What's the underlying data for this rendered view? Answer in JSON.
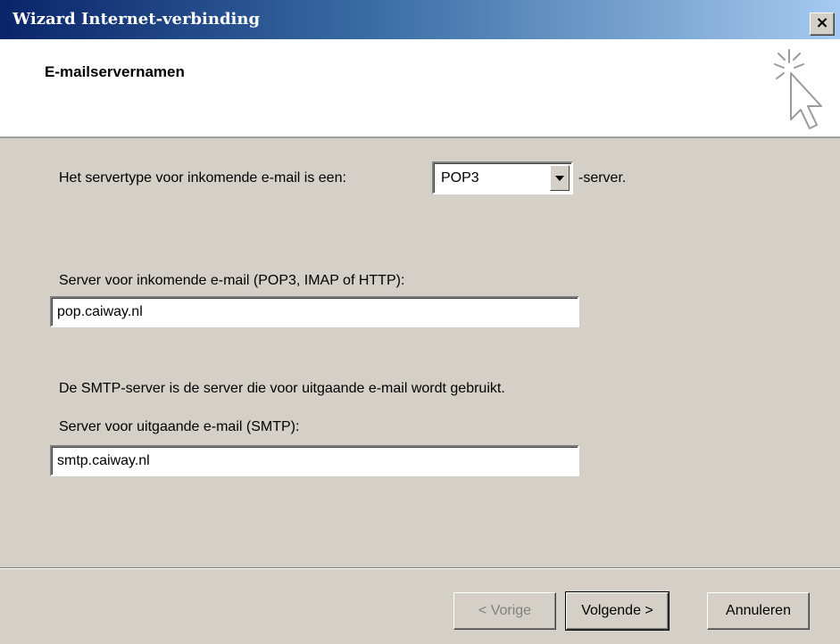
{
  "window": {
    "title": "Wizard Internet-verbinding",
    "close_glyph": "×"
  },
  "header": {
    "title": "E-mailservernamen",
    "icon": "wizard-sparkle-cursor-icon"
  },
  "incoming_type": {
    "prefix": "Het servertype voor inkomende e-mail is een:",
    "selected": "POP3",
    "suffix": "-server."
  },
  "incoming_server": {
    "label": "Server voor inkomende e-mail (POP3, IMAP of HTTP):",
    "value": "pop.caiway.nl"
  },
  "smtp_info": "De SMTP-server is de server die voor uitgaande e-mail wordt gebruikt.",
  "outgoing_server": {
    "label": "Server voor uitgaande e-mail (SMTP):",
    "value": "smtp.caiway.nl"
  },
  "buttons": {
    "back": "< Vorige",
    "next": "Volgende >",
    "cancel": "Annuleren"
  }
}
